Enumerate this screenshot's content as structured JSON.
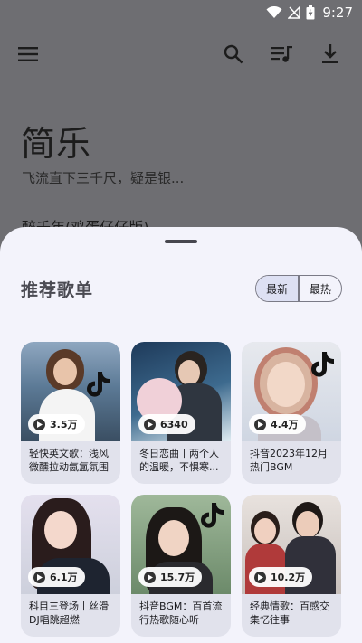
{
  "status": {
    "time": "9:27"
  },
  "icons": [
    "menu-icon",
    "search-icon",
    "playlist-icon",
    "download-icon"
  ],
  "header": {
    "app_title": "简乐",
    "subtitle": "飞流直下三千尺，疑是银...",
    "now_playing": "醉千年(鸡蛋仔仔版)"
  },
  "sheet": {
    "section_title": "推荐歌单",
    "tabs": [
      {
        "label": "最新",
        "active": true
      },
      {
        "label": "最热",
        "active": false
      }
    ],
    "playlists": [
      {
        "title": "轻快英文歌：浅风微醺拉动氤氲氛围",
        "plays": "3.5万"
      },
      {
        "title": "冬日恋曲丨两个人的温暖，不惧寒...",
        "plays": "6340"
      },
      {
        "title": "抖音2023年12月热门BGM",
        "plays": "4.4万"
      },
      {
        "title": "科目三登场丨丝滑DJ唱跳超燃",
        "plays": "6.1万"
      },
      {
        "title": "抖音BGM：百首流行热歌随心听",
        "plays": "15.7万"
      },
      {
        "title": "经典情歌：百感交集忆往事",
        "plays": "10.2万"
      }
    ]
  },
  "colors": {
    "sheet_bg": "#f3f3fb",
    "card_bg": "#e1e2ec",
    "segment_active": "#dde0f3",
    "scrim": "#6e6e72"
  }
}
